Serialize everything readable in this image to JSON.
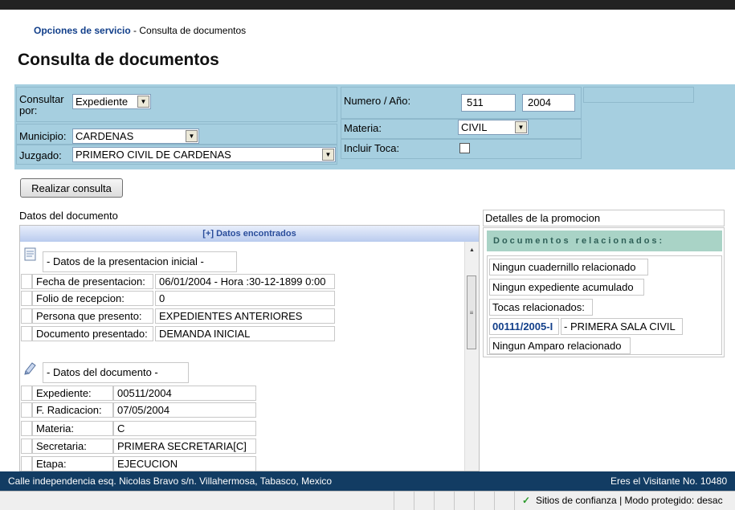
{
  "breadcrumb": {
    "link": "Opciones de servicio",
    "rest": " - Consulta de documentos"
  },
  "page_title": "Consulta de documentos",
  "filters": {
    "consultar_por_label": "Consultar por:",
    "consultar_por_value": "Expediente",
    "municipio_label": "Municipio:",
    "municipio_value": "CARDENAS",
    "juzgado_label": "Juzgado:",
    "juzgado_value": "PRIMERO CIVIL DE CARDENAS",
    "numero_anio_label": "Numero / Año:",
    "numero_value": "511",
    "anio_value": "2004",
    "materia_label": "Materia:",
    "materia_value": "CIVIL",
    "incluir_toca_label": "Incluir Toca:",
    "incluir_toca_checked": false
  },
  "search_button": "Realizar consulta",
  "left": {
    "section_title": "Datos del documento",
    "panel_header": "[+] Datos encontrados",
    "presentacion": {
      "title": "- Datos de la presentacion inicial -",
      "rows": [
        {
          "label": "Fecha de presentacion:",
          "value": "06/01/2004 - Hora :30-12-1899 0:00"
        },
        {
          "label": "Folio de recepcion:",
          "value": "0"
        },
        {
          "label": "Persona que presento:",
          "value": "EXPEDIENTES ANTERIORES"
        },
        {
          "label": "Documento presentado:",
          "value": "DEMANDA INICIAL"
        }
      ]
    },
    "documento": {
      "title": "- Datos del documento -",
      "rows": [
        {
          "label": "Expediente:",
          "value": "00511/2004"
        },
        {
          "label": "F. Radicacion:",
          "value": "07/05/2004"
        },
        {
          "label": "Materia:",
          "value": "C"
        },
        {
          "label": "Secretaria:",
          "value": "PRIMERA SECRETARIA[C]"
        },
        {
          "label": "Etapa:",
          "value": "EJECUCION"
        }
      ]
    }
  },
  "right": {
    "section_title": "Detalles de la promocion",
    "panel_header": "Documentos relacionados:",
    "items": {
      "cuadernillo": "Ningun cuadernillo relacionado",
      "expediente": "Ningun expediente acumulado",
      "tocas_label": "Tocas relacionados:",
      "toca_link": "00111/2005-I",
      "toca_desc": "- PRIMERA SALA CIVIL",
      "amparo": "Ningun Amparo relacionado"
    }
  },
  "footer": {
    "address": "Calle independencia esq. Nicolas Bravo s/n. Villahermosa, Tabasco, Mexico",
    "visitor": "Eres el Visitante No. 10480"
  },
  "statusbar": {
    "zone": "Sitios de confianza | Modo protegido: desac"
  },
  "colors": {
    "filter_bg": "#a6cfe0",
    "footer_bg": "#123c63",
    "link": "#123f8a",
    "related_head": "#a9d3c6"
  }
}
